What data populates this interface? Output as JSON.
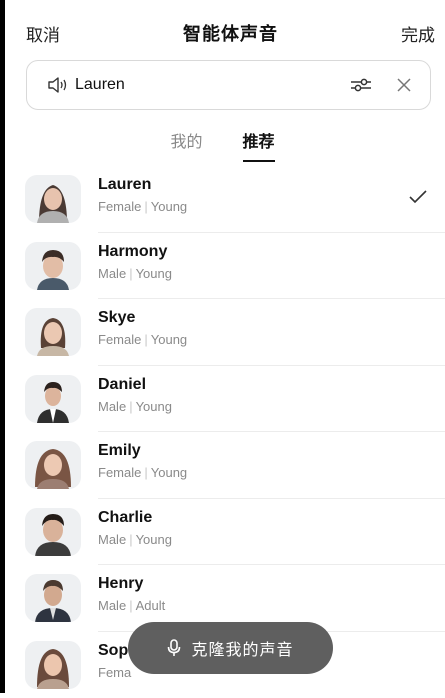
{
  "header": {
    "cancel": "取消",
    "title": "智能体声音",
    "done": "完成"
  },
  "selected_voice": {
    "name": "Lauren"
  },
  "tabs": [
    {
      "label": "我的",
      "active": false
    },
    {
      "label": "推荐",
      "active": true
    }
  ],
  "voices": [
    {
      "name": "Lauren",
      "gender": "Female",
      "age": "Young",
      "selected": true
    },
    {
      "name": "Harmony",
      "gender": "Male",
      "age": "Young",
      "selected": false
    },
    {
      "name": "Skye",
      "gender": "Female",
      "age": "Young",
      "selected": false
    },
    {
      "name": "Daniel",
      "gender": "Male",
      "age": "Young",
      "selected": false
    },
    {
      "name": "Emily",
      "gender": "Female",
      "age": "Young",
      "selected": false
    },
    {
      "name": "Charlie",
      "gender": "Male",
      "age": "Young",
      "selected": false
    },
    {
      "name": "Henry",
      "gender": "Male",
      "age": "Adult",
      "selected": false
    },
    {
      "name": "Sop",
      "gender": "Fema",
      "age": "",
      "selected": false
    }
  ],
  "clone_button": {
    "label": "克隆我的声音",
    "icon": "mic-icon"
  },
  "colors": {
    "button_bg": "#5f5f5f",
    "meta_text": "#8a8a8a",
    "divider": "#ececec"
  }
}
